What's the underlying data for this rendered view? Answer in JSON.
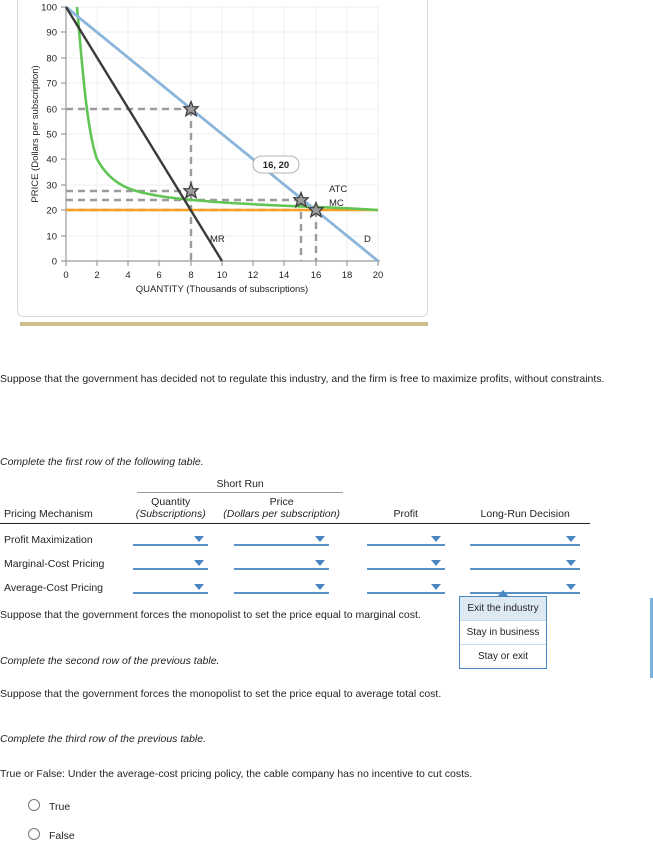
{
  "chart_data": {
    "type": "line",
    "title": "",
    "xlabel": "QUANTITY (Thousands of subscriptions)",
    "ylabel": "PRICE (Dollars per subscription)",
    "xlim": [
      0,
      20
    ],
    "ylim": [
      0,
      100
    ],
    "xticks": [
      0,
      2,
      4,
      6,
      8,
      10,
      12,
      14,
      16,
      18,
      20
    ],
    "yticks": [
      0,
      10,
      20,
      30,
      40,
      50,
      60,
      70,
      80,
      90,
      100
    ],
    "grid": true,
    "legend_position": "inline-right",
    "series": [
      {
        "name": "D",
        "label": "D",
        "color": "#8cb5dc",
        "kind": "line",
        "points": [
          [
            0,
            100
          ],
          [
            20,
            0
          ]
        ]
      },
      {
        "name": "MR",
        "label": "MR",
        "color": "#3b3b3b",
        "kind": "line",
        "points": [
          [
            0,
            100
          ],
          [
            10,
            0
          ]
        ]
      },
      {
        "name": "ATC",
        "label": "ATC",
        "color": "#61c555",
        "kind": "curve",
        "points": [
          [
            0.7,
            100
          ],
          [
            1,
            74
          ],
          [
            1.5,
            52
          ],
          [
            2,
            42
          ],
          [
            3,
            35
          ],
          [
            4,
            31.5
          ],
          [
            5,
            29.5
          ],
          [
            6,
            28
          ],
          [
            7,
            27
          ],
          [
            8,
            26.3
          ],
          [
            10,
            25.4
          ],
          [
            12,
            24.8
          ],
          [
            14,
            24.3
          ],
          [
            16,
            24
          ],
          [
            18,
            23.7
          ],
          [
            20,
            23.5
          ]
        ]
      },
      {
        "name": "MC",
        "label": "MC",
        "color": "#f4a024",
        "kind": "line",
        "points": [
          [
            0,
            20
          ],
          [
            20,
            20
          ]
        ]
      }
    ],
    "markers": [
      {
        "x": 8,
        "y": 60,
        "label": ""
      },
      {
        "x": 8,
        "y": 29,
        "label": ""
      },
      {
        "x": 15,
        "y": 25,
        "label": ""
      },
      {
        "x": 16,
        "y": 20,
        "label": "16, 20"
      }
    ],
    "tooltip": "16, 20",
    "guides": [
      {
        "y": 60,
        "x_to": 8
      },
      {
        "y": 29,
        "x_to": 8
      },
      {
        "y": 25,
        "x_to": 15
      },
      {
        "y": 20,
        "x_to": 16
      },
      {
        "x": 8,
        "y_to": 60
      },
      {
        "x": 15,
        "y_to": 25
      },
      {
        "x": 16,
        "y_to": 20
      }
    ],
    "colors": {
      "demand": "#8cb5dc",
      "marginal_revenue": "#3b3b3b",
      "average_total_cost": "#61c555",
      "marginal_cost": "#f4a024",
      "guide": "#9b9b9b"
    }
  },
  "prose": {
    "intro": "Suppose that the government has decided not to regulate this industry, and the firm is free to maximize profits, without constraints.",
    "complete_first": "Complete the first row of the following table.",
    "mc_prompt": "Suppose that the government forces the monopolist to set the price equal to marginal cost.",
    "complete_second": "Complete the second row of the previous table.",
    "atc_prompt": "Suppose that the government forces the monopolist to set the price equal to average total cost.",
    "complete_third": "Complete the third row of the previous table.",
    "true_false": "True or False: Under the average-cost pricing policy, the cable company has no incentive to cut costs."
  },
  "table": {
    "group_header": "Short Run",
    "headers": {
      "mechanism": "Pricing Mechanism",
      "quantity_top": "Quantity",
      "quantity_sub": "(Subscriptions)",
      "price_top": "Price",
      "price_sub": "(Dollars per subscription)",
      "profit": "Profit",
      "long_run": "Long-Run Decision"
    },
    "rows": [
      {
        "mechanism": "Profit Maximization",
        "quantity": "",
        "price": "",
        "profit": "",
        "long_run": ""
      },
      {
        "mechanism": "Marginal-Cost Pricing",
        "quantity": "",
        "price": "",
        "profit": "",
        "long_run": ""
      },
      {
        "mechanism": "Average-Cost Pricing",
        "quantity": "",
        "price": "",
        "profit": "",
        "long_run": ""
      }
    ]
  },
  "long_run_dropdown": {
    "open": true,
    "options": [
      "Exit the industry",
      "Stay in business",
      "Stay or exit"
    ],
    "highlighted": "Exit the industry"
  },
  "radios": {
    "options": [
      "True",
      "False"
    ],
    "selected": ""
  },
  "colors": {
    "accent": "#5b92c6",
    "divider": "#cfc08b",
    "text": "#231f20"
  }
}
